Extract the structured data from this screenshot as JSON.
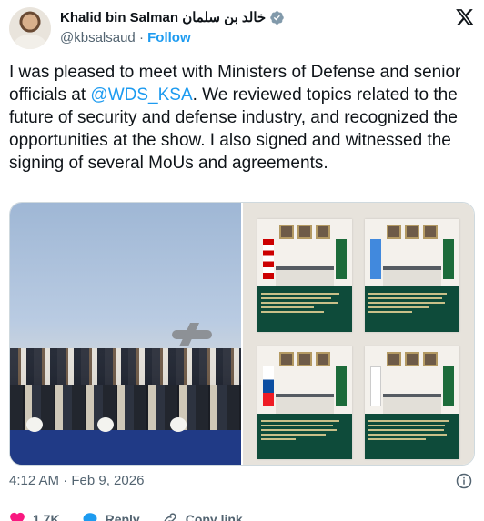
{
  "author": {
    "name": "Khalid bin Salman خالد بن سلمان",
    "handle": "@kbsalsaud",
    "separator": "·",
    "follow_label": "Follow"
  },
  "icons": {
    "verified": "verified-badge-icon",
    "x_logo": "x-logo-icon",
    "info": "info-icon",
    "like": "heart-icon",
    "reply": "reply-bubble-icon",
    "copy_link": "link-icon"
  },
  "colors": {
    "accent": "#1d9bf0",
    "like": "#f91880",
    "muted": "#536471",
    "text": "#0f1419"
  },
  "tweet": {
    "text_before": "I was pleased to meet with Ministers of Defense and senior officials at ",
    "mention": "@WDS_KSA",
    "text_after": ". We reviewed topics related to the future of security and defense industry, and recognized the opportunities at the show. I also signed and witnessed the signing of several MoUs and agreements."
  },
  "media": {
    "left_alt": "group photo",
    "right_alt": "MoU signing collage"
  },
  "timestamp": "4:12 AM · Feb 9, 2026",
  "actions": {
    "like_count": "1.7K",
    "reply_label": "Reply",
    "copy_link_label": "Copy link"
  }
}
